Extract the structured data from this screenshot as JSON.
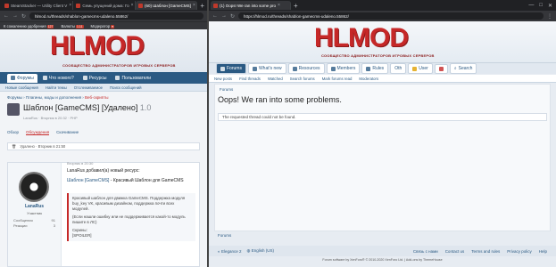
{
  "left": {
    "tabs": [
      "SteamStacker — Utility Client V",
      "Семь упущений дома: Го",
      "(60) Шаблон [GameCMS]"
    ],
    "tab_close": "×",
    "new_tab": "+",
    "window_controls": [
      "—",
      "□",
      "✕"
    ],
    "url": "hlmod.ru/threads/shablon-gamecms-udaleno.55862/",
    "bookmarks": [
      {
        "label": "К сожалению удобрения",
        "badge": "127"
      },
      {
        "label": "Валюты",
        "badge": "1.11"
      },
      {
        "label": "Модератор",
        "badge": "▾"
      }
    ],
    "logo": "HLMOD",
    "logo_sub": "СООБЩЕСТВО АДМИНИСТРАТОРОВ ИГРОВЫХ СЕРВЕРОВ",
    "nav": [
      "Форумы",
      "Что нового?",
      "Ресурсы",
      "Пользователи"
    ],
    "subnav": [
      "Новые сообщения",
      "Найти темы",
      "Отслеживаемое",
      "Поиск сообщений"
    ],
    "crumbs": [
      "Форумы",
      "Плагины, моды и дополнения",
      "Веб-скрипты"
    ],
    "title": "Шаблон [GameCMS] [Удалено]",
    "title_ver": "1.0",
    "meta": "LanaRus · Вторник в 20:32 · PHP",
    "tabs2": [
      "Обзор",
      "Обсуждения",
      "Скачивание"
    ],
    "banner": "Удалено · Вторник в 21:50",
    "post_date": "Вторник в 20:30",
    "user": {
      "name": "LanaRus",
      "role": "Участник",
      "stats": [
        [
          "Сообщения",
          "91"
        ],
        [
          "Реакции",
          "3"
        ]
      ]
    },
    "post_intro": "LanaRus добавил(а) новый ресурс:",
    "post_link": "Шаблон [GameCMS]",
    "post_link_tail": " - Красивый Шаблон для GameCMS",
    "quote": "Красивый шаблон для движка GameCMS. Поддержка модуля buy_key VK, красивым дизайном, поддержка почти всех модулей.",
    "quote2": "(Если нашли ошибку или не поддерживается какой-то модуль пишите в ЛС)",
    "quote3": "Скрины:",
    "quote4": "[SPOILER]"
  },
  "right": {
    "tab": "(1) Oops! We ran into some pro",
    "tab_close": "×",
    "new_tab": "+",
    "window_controls": [
      "—",
      "□",
      "✕"
    ],
    "url": "https://hlmod.ru/threads/shablon-gamecms-udaleno.55862/",
    "logo": "HLMOD",
    "logo_sub": "СООБЩЕСТВО АДМИНИСТРАТОРОВ ИГРОВЫХ СЕРВЕРОВ",
    "nav": [
      "Forums",
      "What's new",
      "Resources",
      "Members",
      "Rules",
      "Oth"
    ],
    "user": "User",
    "search": "Search",
    "subnav": [
      "New posts",
      "Find threads",
      "Watched",
      "Search forums",
      "Mark forums read",
      "Moderators"
    ],
    "crumb": "Forums",
    "heading": "Oops! We ran into some problems.",
    "error": "The requested thread could not be found.",
    "foot_crumb": "Forums",
    "style": "Elegance 2",
    "lang": "English (US)",
    "foot_links": [
      "Связь с нами",
      "Contact us",
      "Terms and rules",
      "Privacy policy",
      "Help"
    ],
    "copyright": "Forum software by XenForo® © 2010-2020 XenForo Ltd. | Add-ons by ThemeHouse"
  }
}
